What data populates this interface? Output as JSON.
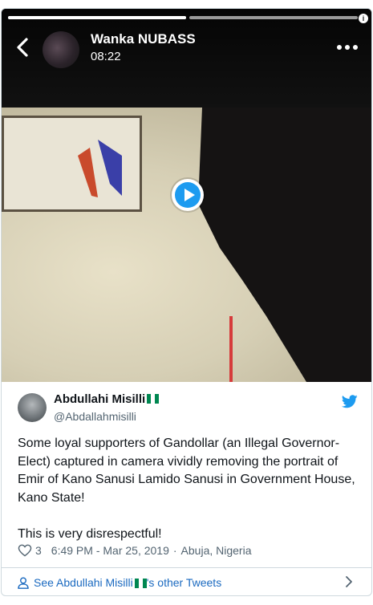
{
  "story": {
    "name": "Wanka NUBASS",
    "time": "08:22",
    "progress": [
      1.0,
      0.0
    ]
  },
  "tweet": {
    "author_name": "Abdullahi Misilli",
    "author_handle": "@Abdallahmisilli",
    "text": "Some loyal supporters of Gandollar (an Illegal Governor-Elect) captured in camera vividly removing the portrait of Emir of Kano Sanusi Lamido Sanusi in Government House, Kano State!\n\nThis is very disrespectful!",
    "like_count": "3",
    "timestamp": "6:49 PM - Mar 25, 2019",
    "separator": "·",
    "location": "Abuja, Nigeria",
    "other_tweets_prefix": "See Abdullahi Misilli",
    "other_tweets_suffix": "'s other Tweets"
  },
  "colors": {
    "twitter_blue": "#1d9bf0",
    "link_blue": "#1b6ac0",
    "flag_green": "#008751"
  },
  "icons": [
    "back-arrow-icon",
    "more-icon",
    "info-icon",
    "play-icon",
    "twitter-bird-icon",
    "heart-icon",
    "person-icon",
    "chevron-right-icon",
    "nigeria-flag-icon"
  ]
}
